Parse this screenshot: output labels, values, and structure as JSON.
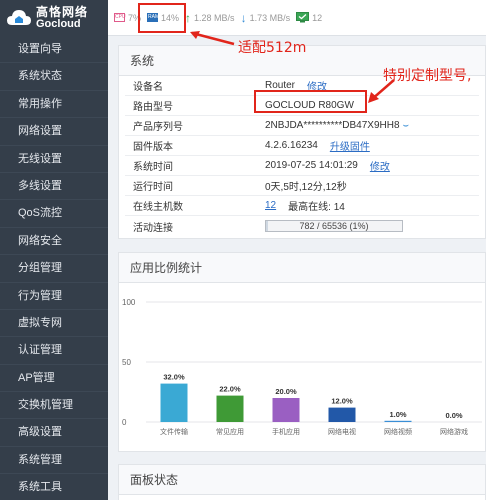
{
  "brand": {
    "name_cn": "高恪网络",
    "name_en": "Gocloud"
  },
  "sidebar": {
    "items": [
      {
        "label": "设置向导"
      },
      {
        "label": "系统状态"
      },
      {
        "label": "常用操作"
      },
      {
        "label": "网络设置"
      },
      {
        "label": "无线设置"
      },
      {
        "label": "多线设置"
      },
      {
        "label": "QoS流控"
      },
      {
        "label": "网络安全"
      },
      {
        "label": "分组管理"
      },
      {
        "label": "行为管理"
      },
      {
        "label": "虚拟专网"
      },
      {
        "label": "认证管理"
      },
      {
        "label": "AP管理"
      },
      {
        "label": "交换机管理"
      },
      {
        "label": "高级设置"
      },
      {
        "label": "系统管理"
      },
      {
        "label": "系统工具"
      }
    ]
  },
  "topbar": {
    "cpu": "7%",
    "mem": "14%",
    "up": "1.28 MB/s",
    "down": "1.73 MB/s",
    "online": "12",
    "cpu_icon": "CPU",
    "mem_icon": "RAM",
    "colors": {
      "cpu": "#e05a8a",
      "mem": "#2a6fb8",
      "up": "#3aa655",
      "down": "#3a8fd6"
    }
  },
  "system": {
    "title": "系统",
    "device_name": {
      "label": "设备名",
      "value": "Router",
      "action": "修改"
    },
    "model": {
      "label": "路由型号",
      "value": "GOCLOUD R80GW"
    },
    "serial": {
      "label": "产品序列号",
      "value": "2NBJDA**********DB47X9HH8"
    },
    "firmware": {
      "label": "固件版本",
      "value": "4.2.6.16234",
      "action": "升级固件"
    },
    "time": {
      "label": "系统时间",
      "value": "2019-07-25 14:01:29",
      "action": "修改"
    },
    "uptime": {
      "label": "运行时间",
      "value": "0天,5时,12分,12秒"
    },
    "online_hosts": {
      "label": "在线主机数",
      "value": "12",
      "peak_label": "最高在线:",
      "peak": "14"
    },
    "connections": {
      "label": "活动连接",
      "value": "782 / 65536 (1%)",
      "fraction": 0.012
    }
  },
  "annotations": {
    "mem_note": "适配512m",
    "model_note": "特别定制型号,"
  },
  "app_panel": {
    "title": "应用比例统计"
  },
  "panel_status": {
    "title": "面板状态"
  },
  "chart_data": {
    "type": "bar",
    "categories": [
      "文件传输",
      "常见应用",
      "手机应用",
      "网络电视",
      "网络视频",
      "网络游戏"
    ],
    "values": [
      32.0,
      22.0,
      20.0,
      12.0,
      1.0,
      0.0
    ],
    "value_labels": [
      "32.0%",
      "22.0%",
      "20.0%",
      "12.0%",
      "1.0%",
      "0.0%"
    ],
    "colors": [
      "#3aa9d4",
      "#3f9a36",
      "#9a5fc2",
      "#2258a8",
      "#3a8fd6",
      "#3a8fd6"
    ],
    "ylim": [
      0,
      100
    ],
    "yticks": [
      "0",
      "50",
      "100"
    ]
  }
}
